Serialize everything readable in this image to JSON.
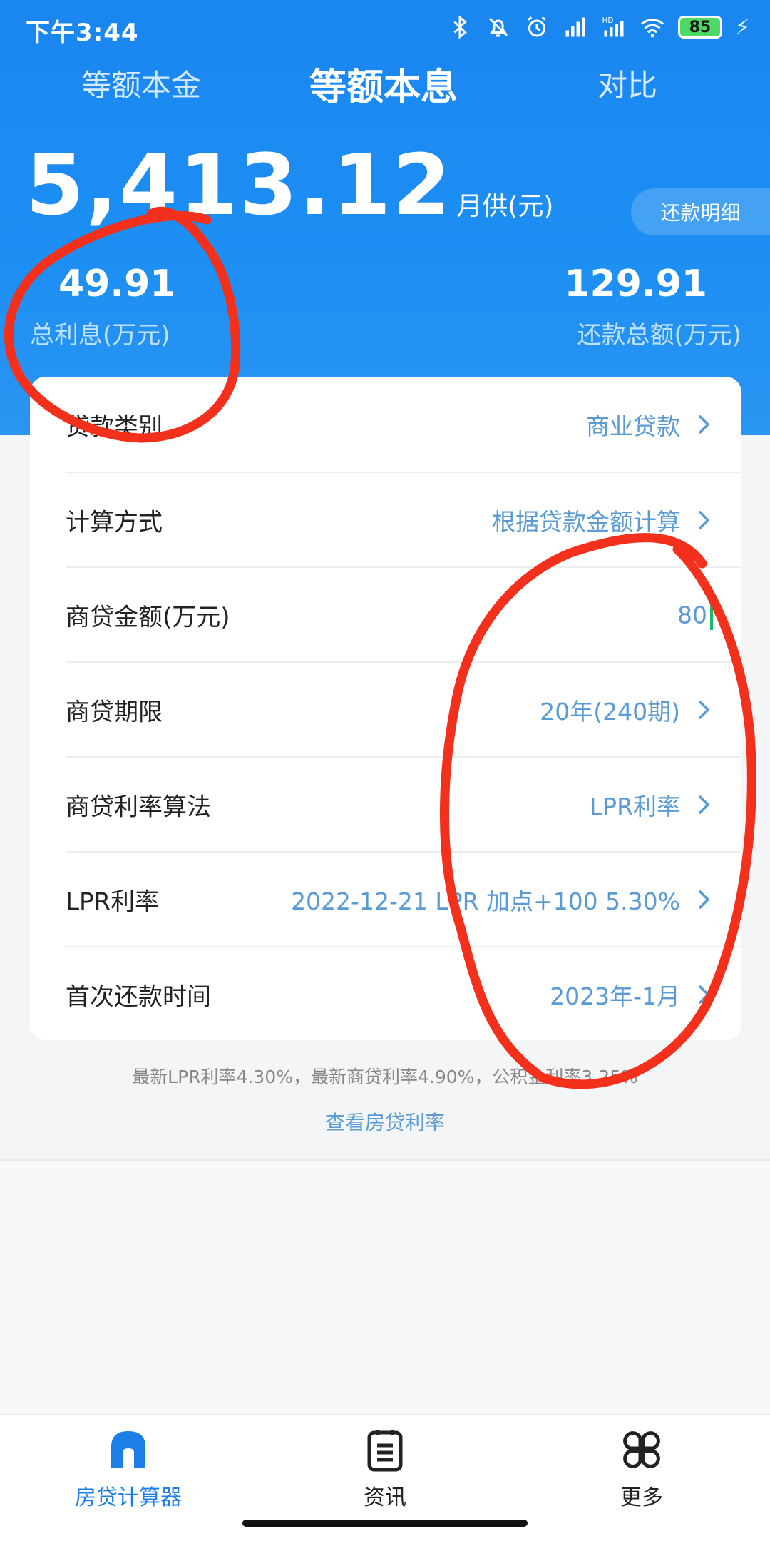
{
  "status_bar": {
    "time": "下午3:44",
    "battery": "85",
    "icons": [
      "bluetooth-icon",
      "mute-icon",
      "alarm-icon",
      "signal-icon",
      "hd-signal-icon",
      "wifi-icon",
      "battery-icon",
      "charging-icon"
    ]
  },
  "tabs": [
    {
      "label": "等额本金",
      "active": false
    },
    {
      "label": "等额本息",
      "active": true
    },
    {
      "label": "对比",
      "active": false
    }
  ],
  "summary": {
    "monthly_payment": "5,413.12",
    "monthly_unit": "月供(元)",
    "detail_button": "还款明细",
    "total_interest_value": "49.91",
    "total_interest_label": "总利息(万元)",
    "total_repayment_value": "129.91",
    "total_repayment_label": "还款总额(万元)"
  },
  "form": {
    "rows": [
      {
        "label": "贷款类别",
        "value": "商业贷款"
      },
      {
        "label": "计算方式",
        "value": "根据贷款金额计算"
      },
      {
        "label": "商贷金额(万元)",
        "value": "80"
      },
      {
        "label": "商贷期限",
        "value": "20年(240期)"
      },
      {
        "label": "商贷利率算法",
        "value": "LPR利率"
      },
      {
        "label": "LPR利率",
        "value": "2022-12-21 LPR 加点+100 5.30%"
      },
      {
        "label": "首次还款时间",
        "value": "2023年-1月"
      }
    ]
  },
  "footer_note": "最新LPR利率4.30%，最新商贷利率4.90%，公积金利率3.25%",
  "footer_link": "查看房贷利率",
  "bottom_nav": [
    {
      "label": "房贷计算器",
      "icon": "house-icon",
      "active": true
    },
    {
      "label": "资讯",
      "icon": "news-icon",
      "active": false
    },
    {
      "label": "更多",
      "icon": "grid-icon",
      "active": false
    }
  ],
  "colors": {
    "header_blue": "#1a86f0",
    "value_blue": "#5a9bd4",
    "nav_active": "#1c7fe8",
    "annotation_red": "#f2301b"
  }
}
